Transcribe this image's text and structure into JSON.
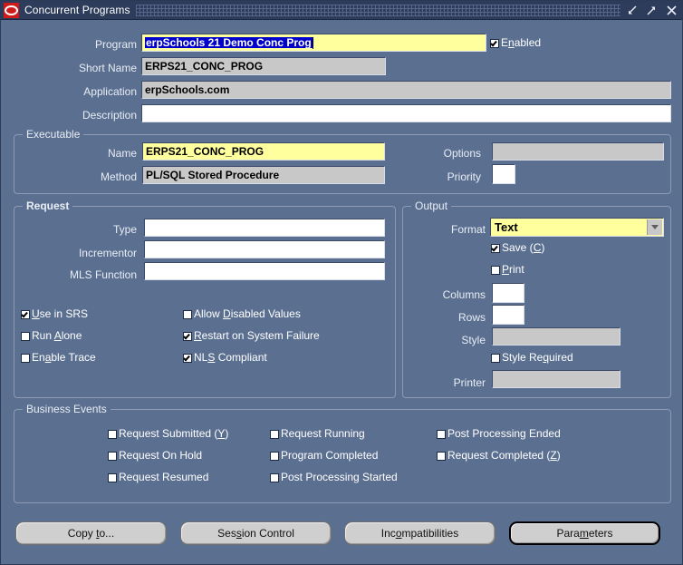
{
  "window": {
    "title": "Concurrent Programs",
    "logo_icon": "oracle-logo-icon",
    "minimize_label": "minimize-icon",
    "maximize_label": "maximize-icon",
    "close_label": "close-icon"
  },
  "header": {
    "program_label": "Program",
    "program_value": "erpSchools 21 Demo Conc Prog",
    "enabled_label": "E<u>n</u>abled",
    "enabled_checked": true,
    "short_name_label": "Short Name",
    "short_name_value": "ERPS21_CONC_PROG",
    "application_label": "Application",
    "application_value": "erpSchools.com",
    "description_label": "Description",
    "description_value": ""
  },
  "executable": {
    "title": "Executable",
    "name_label": "Name",
    "name_value": "ERPS21_CONC_PROG",
    "method_label": "Method",
    "method_value": "PL/SQL Stored Procedure",
    "options_label": "Options",
    "options_value": "",
    "priority_label": "Priority",
    "priority_value": ""
  },
  "request": {
    "title": "Request",
    "type_label": "Type",
    "type_value": "",
    "incrementor_label": "Incrementor",
    "incrementor_value": "",
    "mls_function_label": "MLS Function",
    "mls_function_value": "",
    "checkboxes": [
      {
        "label": "<u>U</u>se in SRS",
        "checked": true
      },
      {
        "label": "Run <u>A</u>lone",
        "checked": false
      },
      {
        "label": "En<u>a</u>ble Trace",
        "checked": false
      },
      {
        "label": "Allow <u>D</u>isabled Values",
        "checked": false
      },
      {
        "label": "<u>R</u>estart on System Failure",
        "checked": true
      },
      {
        "label": "NL<u>S</u> Compliant",
        "checked": true
      }
    ]
  },
  "output": {
    "title": "Output",
    "format_label": "Format",
    "format_value": "Text",
    "save_label": "Save (<u>C</u>)",
    "save_checked": true,
    "print_label": "<u>P</u>rint",
    "print_checked": false,
    "columns_label": "Columns",
    "columns_value": "",
    "rows_label": "Rows",
    "rows_value": "",
    "style_label": "Style",
    "style_value": "",
    "style_required_label": "Style Re<u>q</u>uired",
    "style_required_checked": false,
    "printer_label": "Printer",
    "printer_value": ""
  },
  "business_events": {
    "title": "Business Events",
    "checkboxes": [
      {
        "label": "Request Submitted (<u>Y</u>)",
        "checked": false
      },
      {
        "label": "Request On Hold",
        "checked": false
      },
      {
        "label": "Request Resumed",
        "checked": false
      },
      {
        "label": "Request Running",
        "checked": false
      },
      {
        "label": "Program Completed",
        "checked": false
      },
      {
        "label": "Post Processing Started",
        "checked": false
      },
      {
        "label": "Post Processing Ended",
        "checked": false
      },
      {
        "label": "Request Completed (<u>Z</u>)",
        "checked": false
      }
    ]
  },
  "buttons": [
    {
      "label": "Copy <u>t</u>o...",
      "focused": false
    },
    {
      "label": "Ses<u>s</u>ion Control",
      "focused": false
    },
    {
      "label": "Inc<u>o</u>mpatibilities",
      "focused": false
    },
    {
      "label": "Para<u>m</u>eters",
      "focused": true
    }
  ],
  "colors": {
    "window_background": "#5b7091",
    "titlebar": "#2e3c5b",
    "field_active": "#ffff9e",
    "field_readonly": "#c8c8c8",
    "field_editable": "#ffffff",
    "selection": "#0000cd",
    "logo_red": "#d01b1b",
    "button_face": "#cfcfcf"
  }
}
